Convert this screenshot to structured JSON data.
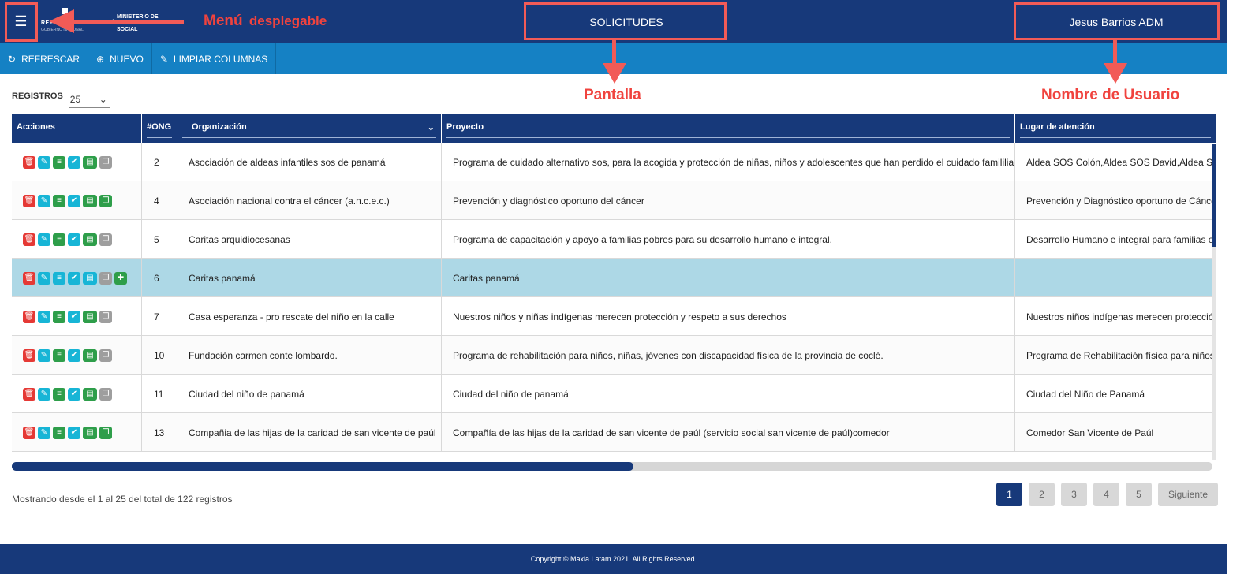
{
  "header": {
    "logo_line1": "REPÚBLICA DE PANAMÁ",
    "logo_line1b": "GOBIERNO NACIONAL",
    "logo_line2": "MINISTERIO DE DESARROLLO SOCIAL",
    "screen_title": "SOLICITUDES",
    "user_name": "Jesus Barrios ADM"
  },
  "annotations": {
    "menu": "Menú",
    "menu_bold": "desplegable",
    "screen": "Pantalla",
    "user": "Nombre de Usuario",
    "color": "#f25b57"
  },
  "toolbar": {
    "refresh": "REFRESCAR",
    "new": "NUEVO",
    "clear_columns": "LIMPIAR COLUMNAS"
  },
  "registros": {
    "label": "REGISTROS",
    "value": "25"
  },
  "table": {
    "headers": {
      "acciones": "Acciones",
      "ong": "#ONG",
      "organizacion": "Organización",
      "proyecto": "Proyecto",
      "lugar": "Lugar de atención"
    },
    "rows": [
      {
        "ong": "2",
        "org": "Asociación de aldeas infantiles sos de panamá",
        "proyecto": "Programa de cuidado alternativo sos, para la acogida y protección de niñas, niños y adolescentes que han perdido el cuidado famililiar",
        "lugar": "Aldea SOS Colón,Aldea SOS David,Aldea SOS"
      },
      {
        "ong": "4",
        "org": "Asociación nacional contra el cáncer (a.n.c.e.c.)",
        "proyecto": "Prevención y diagnóstico oportuno del cáncer",
        "lugar": "Prevención y Diagnóstico oportuno de Cánce"
      },
      {
        "ong": "5",
        "org": "Caritas arquidiocesanas",
        "proyecto": "Programa de capacitación y apoyo a familias pobres para su desarrollo humano e integral.",
        "lugar": "Desarrollo Humano e integral para familias en"
      },
      {
        "ong": "6",
        "org": "Caritas panamá",
        "proyecto": "Caritas panamá",
        "lugar": ""
      },
      {
        "ong": "7",
        "org": "Casa esperanza - pro rescate del niño en la calle",
        "proyecto": "Nuestros niños y niñas indígenas merecen protección y respeto a sus derechos",
        "lugar": "Nuestros niños indígenas merecen protecció"
      },
      {
        "ong": "10",
        "org": "Fundación carmen conte lombardo.",
        "proyecto": "Programa de rehabilitación para niños, niñas, jóvenes con discapacidad física de la provincia de coclé.",
        "lugar": "Programa de Rehabilitación física para niños,"
      },
      {
        "ong": "11",
        "org": "Ciudad del niño de panamá",
        "proyecto": "Ciudad del niño de panamá",
        "lugar": "Ciudad del Niño de Panamá"
      },
      {
        "ong": "13",
        "org": "Compañia de las hijas de la caridad de san vicente de paúl",
        "proyecto": "Compañía de las hijas de la caridad de san vicente de paúl (servicio social san vicente de paúl)comedor",
        "lugar": "Comedor San Vicente de Paúl"
      }
    ]
  },
  "summary": "Mostrando desde el 1 al 25 del total de 122 registros",
  "pagination": {
    "pages": [
      "1",
      "2",
      "3",
      "4",
      "5"
    ],
    "next": "Siguiente",
    "current": "1"
  },
  "footer": "Copyright © Maxia Latam 2021. All Rights Reserved."
}
